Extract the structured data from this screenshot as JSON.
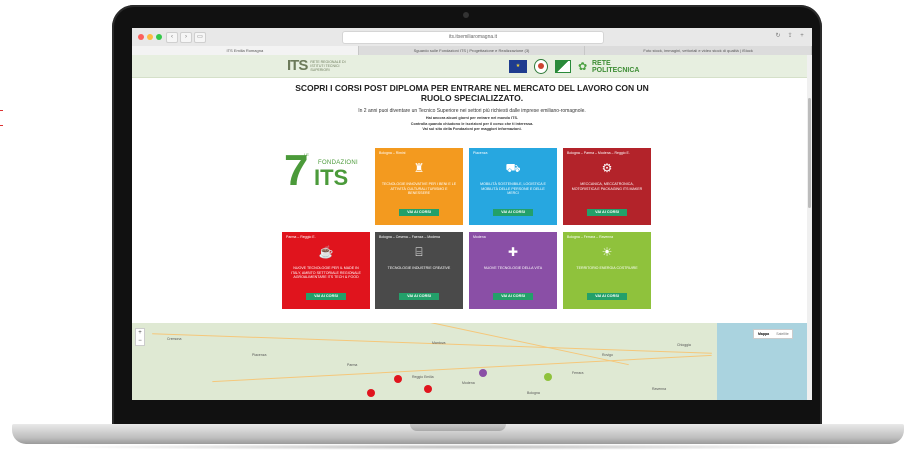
{
  "browser": {
    "address": "its.itsemiliaromagna.it",
    "tabs": [
      {
        "label": "ITS Emilia Romagna",
        "active": true
      },
      {
        "label": "Sguardo sulle Fondazioni ITS | Progettazione e Realizzazione (3)",
        "active": false
      },
      {
        "label": "Foto stock, immagini, vettoriali e video stock di qualità | iStock",
        "active": false
      }
    ],
    "buttons": {
      "back": "‹",
      "forward": "›",
      "sidebar": "▭",
      "share": "⇪",
      "new_tab": "+",
      "reload": "↻"
    }
  },
  "header": {
    "logo_text": "ITS",
    "logo_sub": "Rete regionale di Istituti Tecnici Superiori",
    "partners": {
      "eu": "★",
      "rete_line1": "RETE",
      "rete_line2": "POLITECNICA",
      "rete_icon": "✿"
    }
  },
  "hero": {
    "title_line1": "SCOPRI I CORSI POST DIPLOMA PER ENTRARE NEL MERCATO DEL LAVORO CON UN",
    "title_line2": "RUOLO SPECIALIZZATO.",
    "subtitle": "In 2 anni puoi diventare un Tecnico Superiore nei settori più richiesti dalle imprese emiliano-romagnole.",
    "info": [
      "Hai ancora alcuni giorni per entrare nel mondo ITS.",
      "Controlla quando chiudono le iscrizioni per il corso che ti interessa.",
      "Vai sul sito della Fondazioni per maggiori informazioni."
    ]
  },
  "foundations_logo": {
    "le": "LE",
    "number": "7",
    "word": "FONDAZIONI",
    "its": "ITS"
  },
  "cards": [
    {
      "region": "Bologna – Rimini",
      "title": "Tecnologie innovative per i beni e le attività culturali turismo e benessere",
      "button": "VAI AI CORSI",
      "color": "#f39a1f",
      "icon": "♜",
      "icon_name": "museum-icon"
    },
    {
      "region": "Piacenza",
      "title": "Mobilità sostenibile, logistica e mobilità delle persone e delle merci",
      "button": "VAI AI CORSI",
      "color": "#27a7e0",
      "icon": "⛟",
      "icon_name": "truck-icon"
    },
    {
      "region": "Bologna – Parma – Modena – Reggio E.",
      "title": "Meccanica, meccatronica, motoristica e packaging ITS Maker",
      "button": "VAI AI CORSI",
      "color": "#b3232a",
      "icon": "⚙",
      "icon_name": "engine-icon"
    },
    {
      "region": "Parma – Reggio E.",
      "title": "Nuove tecnologie per il made in Italy, ambito settoriale regionale agroalimentare ITS Tech & Food",
      "button": "VAI AI CORSI",
      "color": "#e0141d",
      "icon": "☕",
      "icon_name": "food-bowl-icon"
    },
    {
      "region": "Bologna – Cesena – Faenza – Modena",
      "title": "Tecnologie industrie creative",
      "button": "VAI AI CORSI",
      "color": "#4a4a4a",
      "icon": "⌸",
      "icon_name": "creative-industry-icon"
    },
    {
      "region": "Modena",
      "title": "Nuove tecnologie della vita",
      "button": "VAI AI CORSI",
      "color": "#8a4fa6",
      "icon": "✚",
      "icon_name": "medical-icon"
    },
    {
      "region": "Bologna – Ferrara – Ravenna",
      "title": "Territorio energia costruire",
      "button": "VAI AI CORSI",
      "color": "#8fc23c",
      "icon": "☀",
      "icon_name": "solar-panel-icon"
    }
  ],
  "map": {
    "toggle": [
      "Mappa",
      "Satellite"
    ],
    "zoom_in": "+",
    "zoom_out": "−",
    "labels": [
      "Cremona",
      "Piacenza",
      "Parma",
      "Reggio Emilia",
      "Modena",
      "Bologna",
      "Ferrara",
      "Ravenna",
      "Mantova",
      "Rovigo",
      "Chioggia"
    ]
  },
  "colors": {
    "header_bg": "#e7efe0",
    "accent_green": "#4b9a3a",
    "button_green": "#23a06a"
  }
}
